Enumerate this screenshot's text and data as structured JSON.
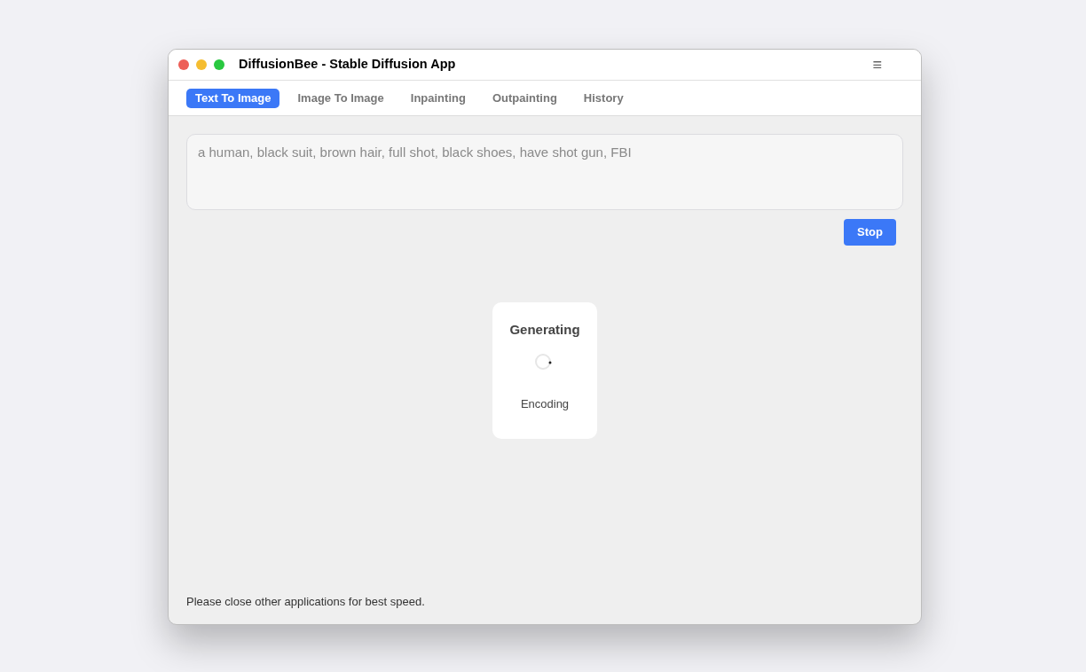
{
  "window": {
    "title": "DiffusionBee - Stable Diffusion App",
    "menu_icon": "≡"
  },
  "tabs": [
    {
      "label": "Text To Image",
      "selected": true
    },
    {
      "label": "Image To Image",
      "selected": false
    },
    {
      "label": "Inpainting",
      "selected": false
    },
    {
      "label": "Outpainting",
      "selected": false
    },
    {
      "label": "History",
      "selected": false
    }
  ],
  "prompt": {
    "value": "a human, black suit, brown hair, full shot, black shoes, have shot gun, FBI"
  },
  "stop_button": "Stop",
  "progress": {
    "title": "Generating",
    "status": "Encoding"
  },
  "status_bar": "Please close other applications for best speed."
}
